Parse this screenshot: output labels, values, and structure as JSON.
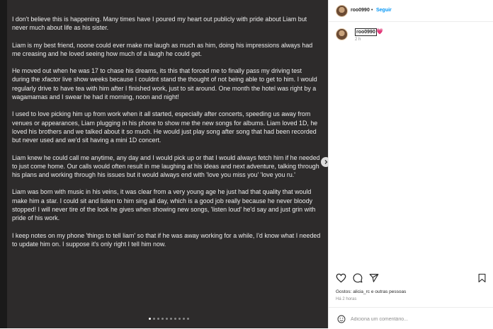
{
  "post": {
    "paragraphs": [
      "I don't believe this is happening. Many times have I poured my heart out publicly with pride about Liam but never much about life as his sister.",
      "Liam is my best friend, noone could ever make me laugh as much as him, doing his impressions always had me creasing and he loved seeing how much of a laugh he could get.",
      "He moved out when he was 17 to chase his dreams, its this that forced me to finally pass my driving test during the xfactor live show weeks because I couldnt stand the thought of not being able to get to him. I would regularly drive to have tea with him after I finished work, just to sit around. One month the hotel was right by a wagamamas and I swear he had it morning, noon and night!",
      "I used to love picking him up from work when it all started, especially after concerts, speeding us away from venues or appearances, Liam plugging in his phone to show me the new songs for albums. Liam loved 1D, he loved his brothers and we talked about it so much. He would just play song after song that had been recorded but never used and we'd sit having a mini 1D concert.",
      "Liam knew he could call me anytime, any day and I would pick up or that I would always fetch him if he needed to just come home. Our calls would often result in me laughing at his ideas and next adventure, talking through his plans and working through his issues but it would always end with 'love you miss you' 'love you ru.'",
      "Liam was born with music in his veins, it was clear from a very young age he just had that quality that would make him a star. I could sit and listen to him sing all day, which is a good job really because he never bloody stopped! I will never tire of the look he gives when showing new songs, 'listen loud' he'd say and just grin with pride of his work.",
      "I keep notes on my phone 'things to tell liam' so that if he was away working for a while, I'd know what I needed to update him on. I suppose it's only right I tell him now."
    ],
    "carousel_dots": 10,
    "active_dot": 0
  },
  "header": {
    "username": "roo0990",
    "separator": "•",
    "follow_label": "Seguir"
  },
  "caption": {
    "username": "roo0990",
    "heart": "💗",
    "time": "2 h"
  },
  "icons": [
    "heart-icon",
    "comment-icon",
    "share-icon",
    "bookmark-icon",
    "emoji-icon"
  ],
  "likes": {
    "text": "Gostos: alicia_rc e outras pessoas"
  },
  "posted_time": "Há 2 horas",
  "comment": {
    "placeholder": "Adiciona um comentário..."
  },
  "colors": {
    "post_background": "#2d2b2b",
    "post_text": "#ededed",
    "follow_blue": "#0095f6",
    "heart_pink": "#e1306c"
  }
}
